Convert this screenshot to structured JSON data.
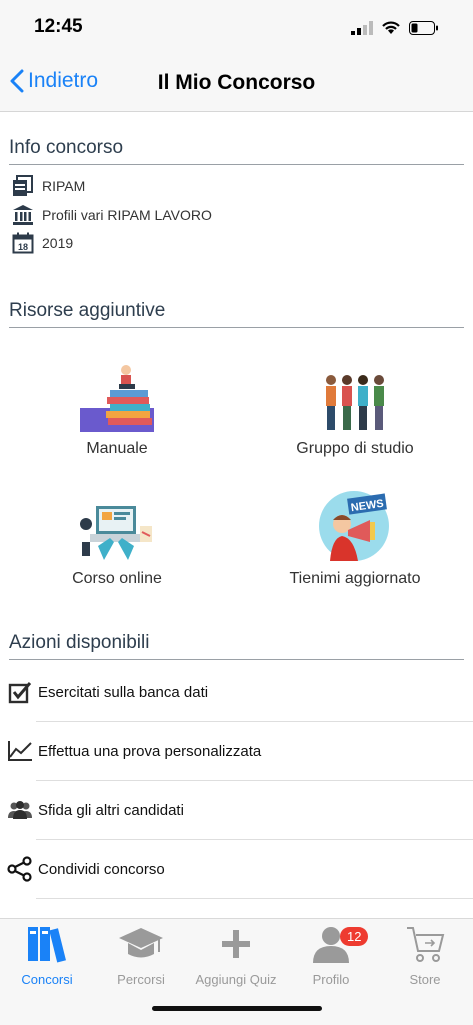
{
  "status_bar": {
    "time": "12:45"
  },
  "navbar": {
    "back_label": "Indietro",
    "title": "Il Mio Concorso"
  },
  "info": {
    "title": "Info concorso",
    "items": [
      {
        "icon": "document-icon",
        "text": "RIPAM"
      },
      {
        "icon": "institution-icon",
        "text": "Profili vari RIPAM LAVORO"
      },
      {
        "icon": "calendar-icon",
        "text": "2019"
      }
    ]
  },
  "resources": {
    "title": "Risorse aggiuntive",
    "items": [
      {
        "label": "Manuale"
      },
      {
        "label": "Gruppo di studio"
      },
      {
        "label": "Corso online"
      },
      {
        "label": "Tienimi aggiornato"
      }
    ],
    "news_text": "NEWS"
  },
  "actions": {
    "title": "Azioni disponibili",
    "items": [
      {
        "icon": "checkbox-icon",
        "label": "Esercitati sulla banca dati"
      },
      {
        "icon": "line-chart-icon",
        "label": "Effettua una prova personalizzata"
      },
      {
        "icon": "users-icon",
        "label": "Sfida gli altri candidati"
      },
      {
        "icon": "share-icon",
        "label": "Condividi concorso"
      }
    ]
  },
  "tabbar": {
    "tabs": [
      {
        "label": "Concorsi",
        "active": true
      },
      {
        "label": "Percorsi"
      },
      {
        "label": "Aggiungi Quiz"
      },
      {
        "label": "Profilo",
        "badge": "12"
      },
      {
        "label": "Store"
      }
    ]
  },
  "colors": {
    "accent": "#1a82f7",
    "badge": "#ee3b30"
  }
}
